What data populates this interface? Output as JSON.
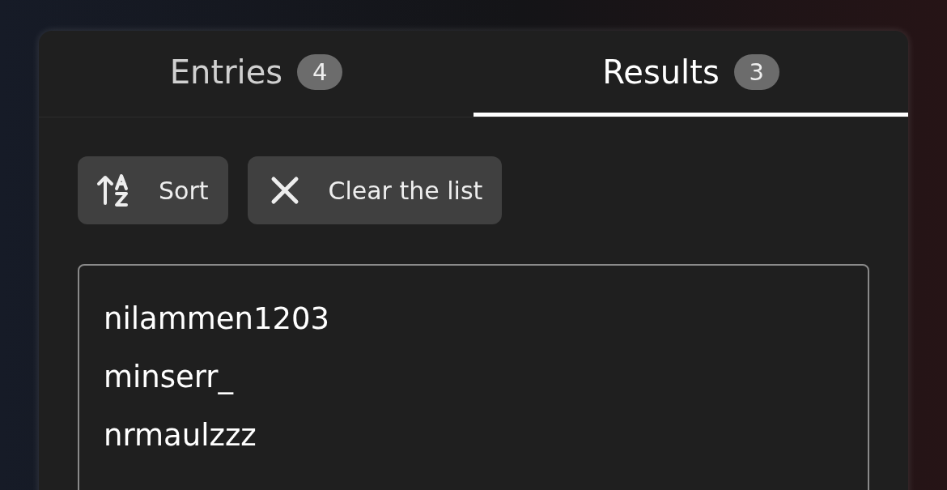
{
  "tabs": [
    {
      "label": "Entries",
      "count": "4",
      "selected": false
    },
    {
      "label": "Results",
      "count": "3",
      "selected": true
    }
  ],
  "toolbar": [
    {
      "kind": "sort",
      "label": "Sort"
    },
    {
      "kind": "clear",
      "label": "Clear the list"
    }
  ],
  "results_field": {
    "lines": [
      "nilammen1203",
      "minserr_",
      "nrmaulzzz"
    ]
  }
}
